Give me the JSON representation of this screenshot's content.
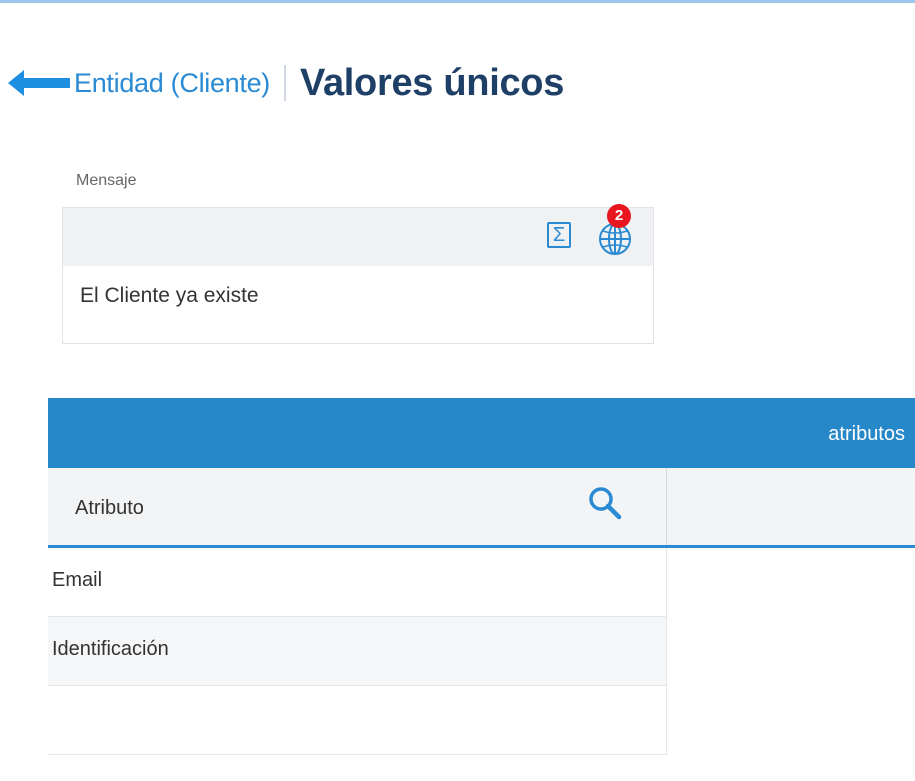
{
  "header": {
    "back_icon": "arrow-left-icon",
    "breadcrumb": "Entidad (Cliente)",
    "title": "Valores únicos",
    "accent_color": "#2a8ad4",
    "title_color": "#1e3f66"
  },
  "mensaje_field": {
    "label": "Mensaje",
    "value": "El Cliente ya existe",
    "toolbar": {
      "sigma_icon": "sigma-icon",
      "sigma_glyph": "Σ",
      "globe_icon": "globe-icon",
      "badge_count": "2",
      "badge_color": "#e8161e"
    }
  },
  "table": {
    "group_header": "atributos",
    "header_color": "#2788c9",
    "columns": [
      {
        "label": "Atributo",
        "search_icon": "search-icon"
      },
      {
        "label": ""
      }
    ],
    "rows": [
      {
        "atributo": "Email"
      },
      {
        "atributo": "Identificación"
      },
      {
        "atributo": ""
      }
    ]
  }
}
